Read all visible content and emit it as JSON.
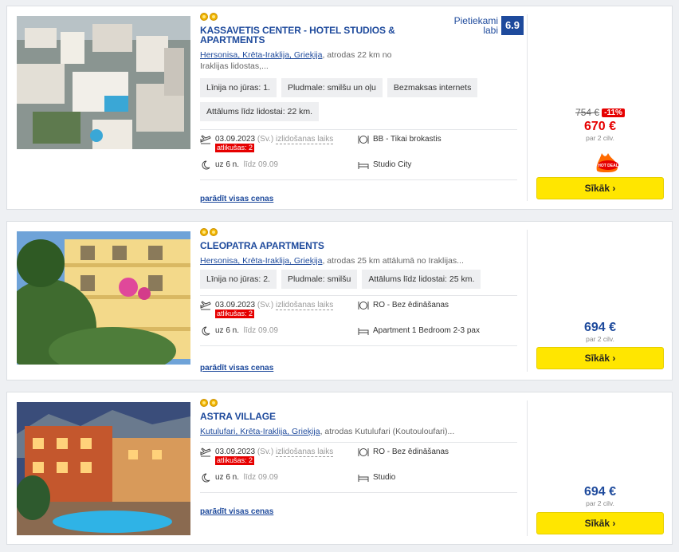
{
  "ui": {
    "button_label": "Sīkāk",
    "per_persons": "par 2 cilv.",
    "show_all": "parādīt visas cenas",
    "departure_time_label": "izlidošanas laiks",
    "remaining_label": "atlikušas: 2",
    "until_label": "līdz",
    "hot_label": "HOT DEAL"
  },
  "hotels": [
    {
      "name": "KASSAVETIS CENTER - HOTEL STUDIOS & APARTMENTS",
      "location_link": "Hersonisa, Krēta-Iraklija, Grieķija",
      "location_rest": ", atrodas 22 km no Iraklijas lidostas,...",
      "tags": [
        "Līnija no jūras: 1.",
        "Pludmale: smilšu un oļu",
        "Bezmaksas internets",
        "Attālums līdz lidostai: 22 km."
      ],
      "date": "03.09.2023",
      "weekday": "(Sv.)",
      "board": "BB - Tikai brokastis",
      "duration": "uz 6 n.",
      "until_date": "09.09",
      "room": "Studio City",
      "rating_text_1": "Pietiekami",
      "rating_text_2": "labi",
      "rating_score": "6.9",
      "old_price": "754 €",
      "discount": "-11%",
      "price": "670 €",
      "stars": 2,
      "hot_deal": true
    },
    {
      "name": "CLEOPATRA APARTMENTS",
      "location_link": "Hersonisa, Krēta-Iraklija, Grieķija",
      "location_rest": ", atrodas 25 km attālumā no Iraklijas...",
      "tags": [
        "Līnija no jūras: 2.",
        "Pludmale: smilšu",
        "Attālums līdz lidostai: 25 km."
      ],
      "date": "03.09.2023",
      "weekday": "(Sv.)",
      "board": "RO - Bez ēdināšanas",
      "duration": "uz 6 n.",
      "until_date": "09.09",
      "room": "Apartment 1 Bedroom 2-3 pax",
      "price": "694 €",
      "stars": 2
    },
    {
      "name": "ASTRA VILLAGE",
      "location_link": "Kutulufari, Krēta-Iraklija, Grieķija",
      "location_rest": ", atrodas Kutulufari (Koutouloufari)...",
      "tags": [],
      "date": "03.09.2023",
      "weekday": "(Sv.)",
      "board": "RO - Bez ēdināšanas",
      "duration": "uz 6 n.",
      "until_date": "09.09",
      "room": "Studio",
      "price": "694 €",
      "stars": 2
    }
  ],
  "colors": {
    "brand_blue": "#1e4a9c",
    "button_yellow": "#ffe600",
    "sale_red": "#e60000"
  }
}
